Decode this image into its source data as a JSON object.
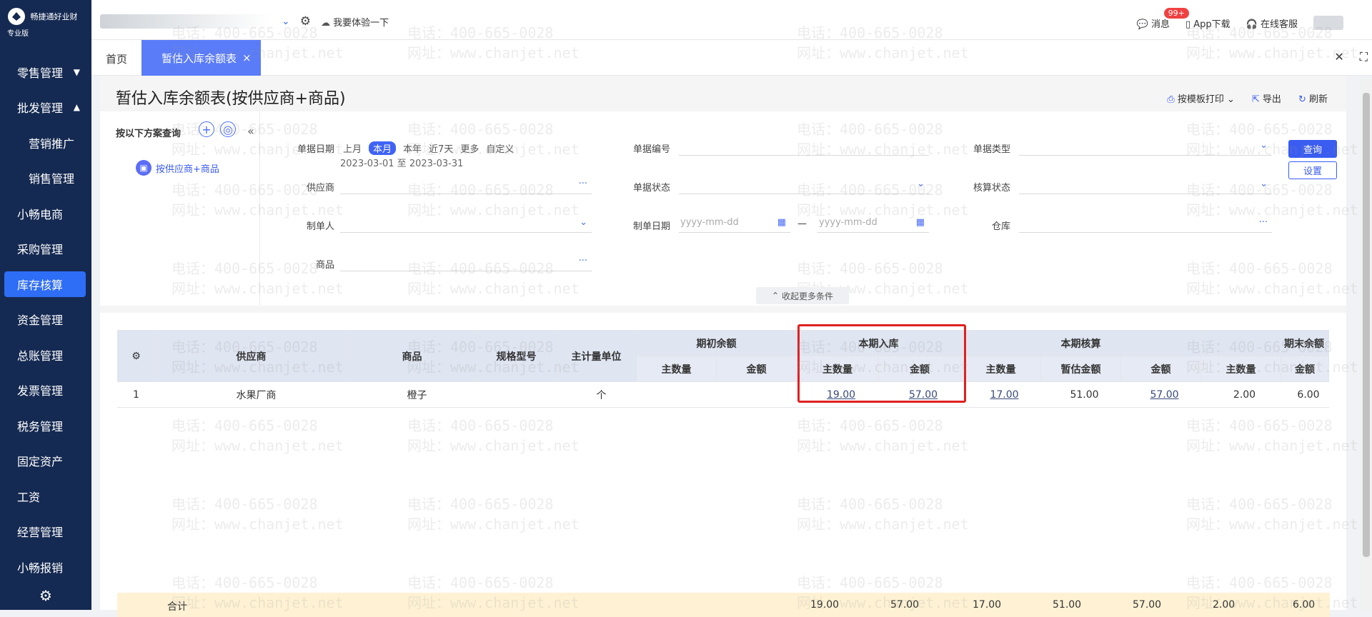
{
  "brand": {
    "name": "畅捷通好业财",
    "edition": "专业版"
  },
  "sidebar": {
    "items": [
      {
        "label": "零售管理",
        "caret": "▼"
      },
      {
        "label": "批发管理",
        "caret": "▲"
      },
      {
        "label": "营销推广"
      },
      {
        "label": "销售管理"
      },
      {
        "label": "小畅电商"
      },
      {
        "label": "采购管理"
      },
      {
        "label": "库存核算"
      },
      {
        "label": "资金管理"
      },
      {
        "label": "总账管理"
      },
      {
        "label": "发票管理"
      },
      {
        "label": "税务管理"
      },
      {
        "label": "固定资产"
      },
      {
        "label": "工资"
      },
      {
        "label": "经营管理"
      },
      {
        "label": "小畅报销"
      }
    ],
    "footer_icon": "gear-icon"
  },
  "topbar": {
    "experience": "我要体验一下",
    "messages": "消息",
    "badge": "99+",
    "app_download": "App下载",
    "service": "在线客服"
  },
  "tabs": {
    "home": "首页",
    "active": "暂估入库余额表",
    "close": "×"
  },
  "page": {
    "title": "暂估入库余额表(按供应商+商品)",
    "actions": {
      "print": "按模板打印",
      "export": "导出",
      "refresh": "刷新"
    }
  },
  "filter": {
    "plan_title": "按以下方案查询",
    "plan_item": "按供应商+商品",
    "date_label": "单据日期",
    "quick": [
      "上月",
      "本月",
      "本年",
      "近7天",
      "更多",
      "自定义"
    ],
    "date_range": "2023-03-01 至 2023-03-31",
    "doc_no_label": "单据编号",
    "doc_type_label": "单据类型",
    "supplier_label": "供应商",
    "doc_status_label": "单据状态",
    "acc_status_label": "核算状态",
    "maker_label": "制单人",
    "make_date_label": "制单日期",
    "date_placeholder": "yyyy-mm-dd",
    "dash": "—",
    "warehouse_label": "仓库",
    "goods_label": "商品",
    "query_btn": "查询",
    "settings_btn": "设置",
    "more": "收起更多条件"
  },
  "table": {
    "headers": {
      "supplier": "供应商",
      "goods": "商品",
      "spec": "规格型号",
      "unit": "主计量单位",
      "opening": "期初余额",
      "incoming": "本期入库",
      "accounting": "本期核算",
      "closing": "期末余额",
      "qty": "主数量",
      "amount": "金额",
      "est_amount": "暂估金额"
    },
    "rows": [
      {
        "no": "1",
        "supplier": "水果厂商",
        "goods": "橙子",
        "unit": "个",
        "in_qty": "19.00",
        "in_amt": "57.00",
        "acc_qty": "17.00",
        "acc_est": "51.00",
        "acc_amt": "57.00",
        "end_qty": "2.00",
        "end_amt": "6.00"
      }
    ],
    "total": {
      "label": "合计",
      "in_qty": "19.00",
      "in_amt": "57.00",
      "acc_qty": "17.00",
      "acc_est": "51.00",
      "acc_amt": "57.00",
      "end_qty": "2.00",
      "end_amt": "6.00"
    }
  },
  "watermark": {
    "phone": "电话：400-665-0028",
    "site": "网址：www.chanjet.net"
  }
}
